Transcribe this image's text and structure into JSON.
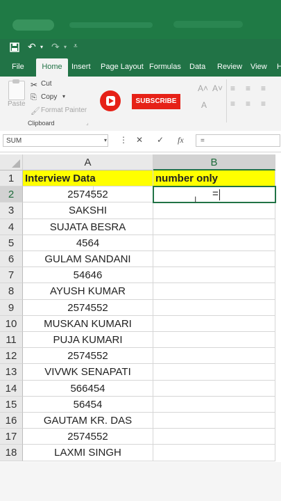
{
  "qat": {
    "save_icon": "save-icon",
    "undo_icon": "undo-icon",
    "redo_icon": "redo-icon",
    "customize_icon": "customize-qat-icon"
  },
  "tabs": [
    {
      "label": "File"
    },
    {
      "label": "Home",
      "active": true
    },
    {
      "label": "Insert"
    },
    {
      "label": "Page Layout"
    },
    {
      "label": "Formulas"
    },
    {
      "label": "Data"
    },
    {
      "label": "Review"
    },
    {
      "label": "View"
    },
    {
      "label": "H"
    }
  ],
  "ribbon": {
    "paste_label": "Paste",
    "cut_label": "Cut",
    "copy_label": "Copy",
    "format_painter_label": "Format Painter",
    "clipboard_group_label": "Clipboard",
    "subscribe_label": "SUBSCRIBE"
  },
  "formula_bar": {
    "name_box": "SUM",
    "cancel_symbol": "✕",
    "enter_symbol": "✓",
    "fx_label": "fx",
    "formula": "="
  },
  "columns": [
    "A",
    "B"
  ],
  "rows": [
    {
      "num": "1",
      "a": "Interview Data",
      "b": "number only"
    },
    {
      "num": "2",
      "a": "2574552",
      "b": "="
    },
    {
      "num": "3",
      "a": "SAKSHI",
      "b": ""
    },
    {
      "num": "4",
      "a": "SUJATA BESRA",
      "b": ""
    },
    {
      "num": "5",
      "a": "4564",
      "b": ""
    },
    {
      "num": "6",
      "a": "GULAM SANDANI",
      "b": ""
    },
    {
      "num": "7",
      "a": "54646",
      "b": ""
    },
    {
      "num": "8",
      "a": "AYUSH KUMAR",
      "b": ""
    },
    {
      "num": "9",
      "a": "2574552",
      "b": ""
    },
    {
      "num": "10",
      "a": "MUSKAN KUMARI",
      "b": ""
    },
    {
      "num": "11",
      "a": "PUJA KUMARI",
      "b": ""
    },
    {
      "num": "12",
      "a": "2574552",
      "b": ""
    },
    {
      "num": "13",
      "a": "VIVWK SENAPATI",
      "b": ""
    },
    {
      "num": "14",
      "a": "566454",
      "b": ""
    },
    {
      "num": "15",
      "a": "56454",
      "b": ""
    },
    {
      "num": "16",
      "a": "GAUTAM KR. DAS",
      "b": ""
    },
    {
      "num": "17",
      "a": "2574552",
      "b": ""
    },
    {
      "num": "18",
      "a": "LAXMI SINGH",
      "b": ""
    }
  ],
  "active_cell": "B2",
  "colors": {
    "excel_green": "#217346",
    "header_yellow": "#ffff00",
    "youtube_red": "#e62117"
  }
}
